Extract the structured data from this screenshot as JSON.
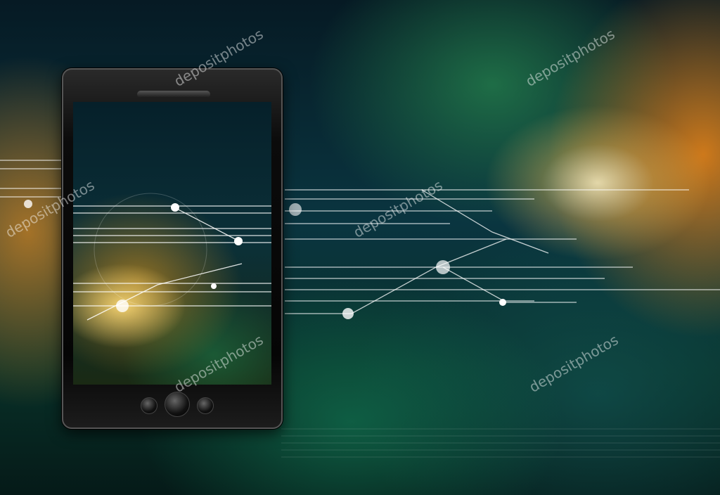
{
  "image": {
    "description_subject": "smartphone",
    "watermark": "depositphotos",
    "colors": {
      "background": "#0a3540",
      "glow": "#ffb030",
      "phone_body": "#0b0b0b"
    },
    "phone": {
      "buttons": 3
    }
  }
}
